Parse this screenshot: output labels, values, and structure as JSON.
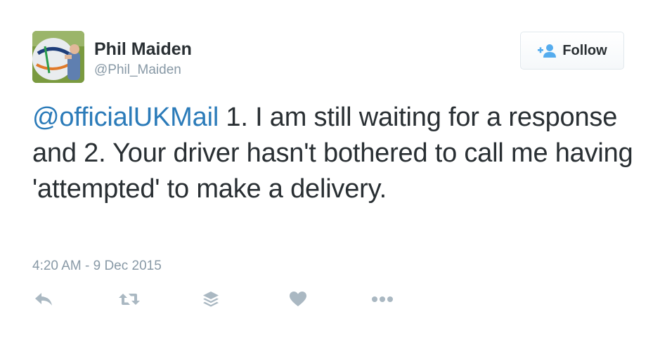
{
  "user": {
    "name": "Phil Maiden",
    "handle": "@Phil_Maiden",
    "avatar_icon": "football-photo-avatar"
  },
  "follow_button": {
    "icon": "add-user-icon",
    "label": "Follow"
  },
  "tweet": {
    "mention": "@officialUKMail",
    "text": " 1. I am still waiting for a response and 2. Your driver hasn't bothered to call me having 'attempted' to make a delivery.",
    "timestamp": "4:20 AM - 9 Dec 2015"
  },
  "actions": [
    {
      "name": "reply",
      "icon": "reply-icon"
    },
    {
      "name": "retweet",
      "icon": "retweet-icon"
    },
    {
      "name": "buffer",
      "icon": "stack-icon"
    },
    {
      "name": "like",
      "icon": "heart-icon"
    },
    {
      "name": "more",
      "icon": "more-icon"
    }
  ],
  "colors": {
    "link": "#2b7bb9",
    "muted": "#8899a6",
    "text": "#292f33",
    "icon": "#aab8c2"
  }
}
